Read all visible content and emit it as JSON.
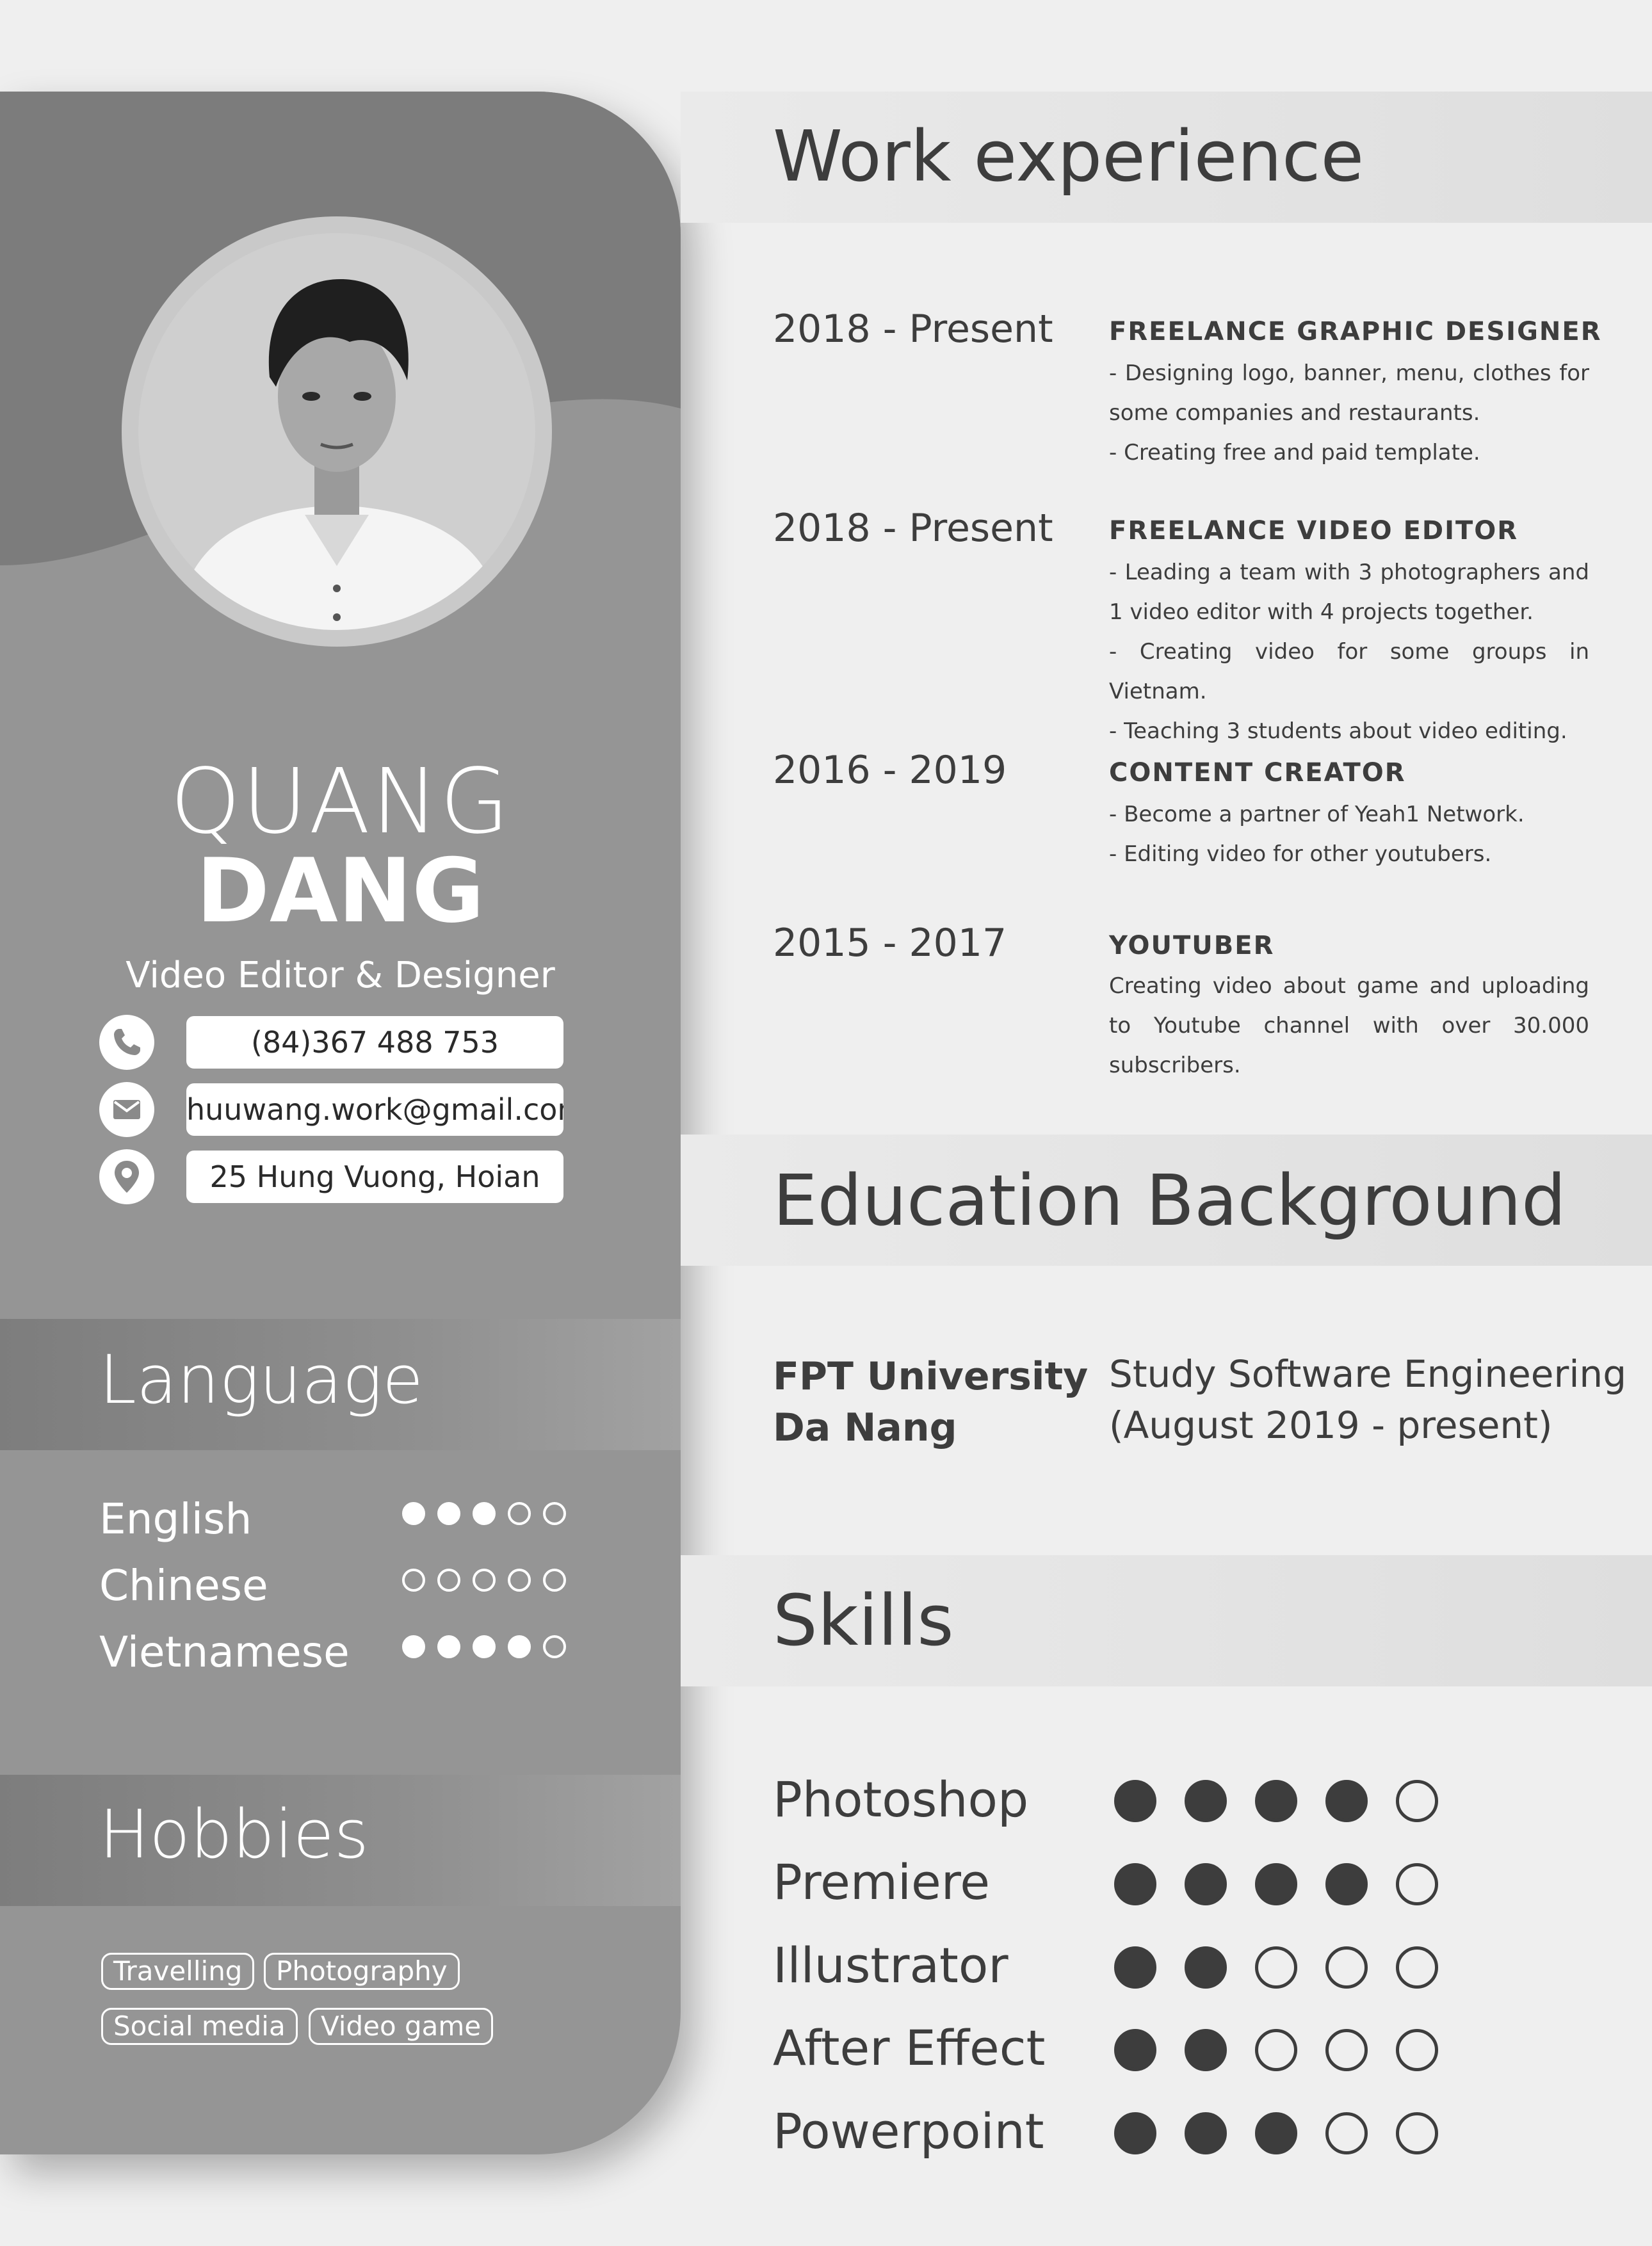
{
  "profile": {
    "first_name": "QUANG",
    "last_name": "DANG",
    "job_title": "Video Editor & Designer"
  },
  "contact": [
    {
      "icon": "phone-icon",
      "value": "(84)367 488 753"
    },
    {
      "icon": "mail-icon",
      "value": "huuwang.work@gmail.com"
    },
    {
      "icon": "location-pin-icon",
      "value": "25 Hung Vuong, Hoian"
    }
  ],
  "language": {
    "heading": "Language",
    "items": [
      {
        "name": "English",
        "level": 3,
        "max": 5
      },
      {
        "name": "Chinese",
        "level": 0,
        "max": 5
      },
      {
        "name": "Vietnamese",
        "level": 4,
        "max": 5
      }
    ]
  },
  "hobbies": {
    "heading": "Hobbies",
    "items": [
      "Travelling",
      "Photography",
      "Social media",
      "Video game"
    ]
  },
  "work": {
    "heading": "Work experience",
    "items": [
      {
        "date": "2018 - Present",
        "title": "FREELANCE GRAPHIC DESIGNER",
        "lines": [
          "- Designing logo, banner, menu, clothes for some companies and restaurants.",
          "- Creating free and paid template."
        ]
      },
      {
        "date": "2018 - Present",
        "title": "FREELANCE VIDEO EDITOR",
        "lines": [
          "- Leading a team with 3 photographers and 1 video editor with 4 projects together.",
          "- Creating video for some groups in Vietnam.",
          "- Teaching 3 students about video editing."
        ]
      },
      {
        "date": "2016 - 2019",
        "title": "CONTENT CREATOR",
        "lines": [
          "- Become a partner of Yeah1 Network.",
          "- Editing video for other youtubers."
        ]
      },
      {
        "date": "2015 - 2017",
        "title": "YOUTUBER",
        "lines": [
          "Creating video about game and uploading to Youtube channel with over 30.000 subscribers."
        ]
      }
    ]
  },
  "education": {
    "heading": "Education Background",
    "school_line1": "FPT University",
    "school_line2": "Da Nang",
    "detail_line1": "Study Software Engineering",
    "detail_line2": "(August 2019 - present)"
  },
  "skills": {
    "heading": "Skills",
    "items": [
      {
        "name": "Photoshop",
        "level": 4,
        "max": 5
      },
      {
        "name": "Premiere",
        "level": 4,
        "max": 5
      },
      {
        "name": "Illustrator",
        "level": 2,
        "max": 5
      },
      {
        "name": "After Effect",
        "level": 2,
        "max": 5
      },
      {
        "name": "Powerpoint",
        "level": 3,
        "max": 5
      }
    ]
  },
  "colors": {
    "sidebar": "#959595",
    "sidebar_dark": "#7c7c7c",
    "page": "#efefef",
    "text": "#3d3d3d"
  }
}
